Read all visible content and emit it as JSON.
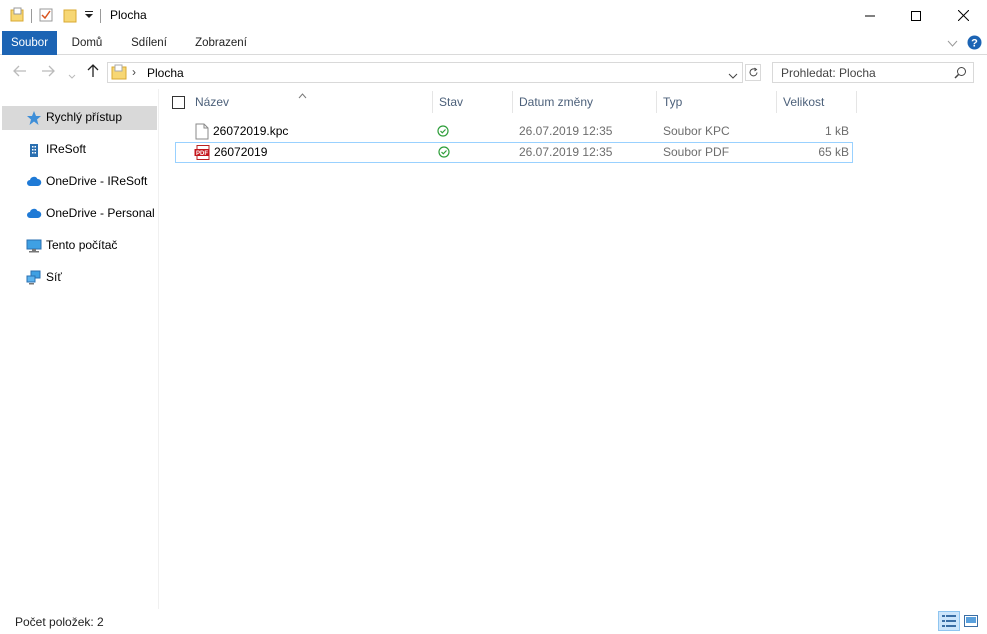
{
  "window": {
    "title": "Plocha"
  },
  "ribbon": {
    "tabs": [
      "Soubor",
      "Domů",
      "Sdílení",
      "Zobrazení"
    ]
  },
  "address_bar": {
    "path": "Plocha",
    "search_placeholder": "Prohledat: Plocha"
  },
  "nav_pane": {
    "items": [
      {
        "label": "Rychlý přístup",
        "icon": "star-icon",
        "selected": true
      },
      {
        "label": "IReSoft",
        "icon": "building-icon",
        "selected": false
      },
      {
        "label": "OneDrive - IReSoft",
        "icon": "cloud-icon",
        "selected": false
      },
      {
        "label": "OneDrive - Personal",
        "icon": "cloud-icon",
        "selected": false
      },
      {
        "label": "Tento počítač",
        "icon": "computer-icon",
        "selected": false
      },
      {
        "label": "Síť",
        "icon": "network-icon",
        "selected": false
      }
    ]
  },
  "file_list": {
    "columns": [
      "Název",
      "Stav",
      "Datum změny",
      "Typ",
      "Velikost"
    ],
    "rows": [
      {
        "name": "26072019.kpc",
        "icon": "file-icon",
        "date": "26.07.2019 12:35",
        "type": "Soubor KPC",
        "size": "1 kB"
      },
      {
        "name": "26072019",
        "icon": "pdf-icon",
        "date": "26.07.2019 12:35",
        "type": "Soubor PDF",
        "size": "65 kB"
      }
    ]
  },
  "status_bar": {
    "text": "Počet položek: 2"
  },
  "colors": {
    "accent": "#1c64b4",
    "selection": "#d9d9d9",
    "focus_border": "#99d1ff",
    "sync_ok": "#2e9e3a",
    "cloud": "#1f7ad6"
  }
}
